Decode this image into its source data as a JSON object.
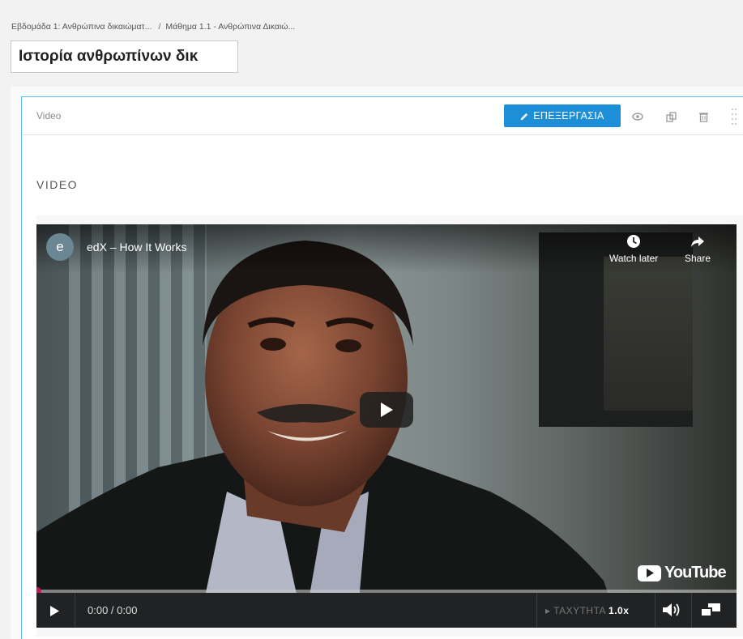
{
  "breadcrumb": {
    "week": "Εβδομάδα 1: Ανθρώπινα δικαιώματ...",
    "separator": "/",
    "lesson": "Μάθημα 1.1 - Ανθρώπινα Δικαιώ..."
  },
  "unit_title": "Ιστορία ανθρωπίνων δικ",
  "component": {
    "type_label": "Video",
    "edit_label": "ΕΠΕΞΕΡΓΑΣΙΑ",
    "section_title": "VIDEO",
    "icons": [
      "pencil-icon",
      "eye-icon",
      "duplicate-icon",
      "delete-icon",
      "drag-handle-icon"
    ]
  },
  "player": {
    "channel_initial": "e",
    "video_title": "edX – How It Works",
    "watch_later_label": "Watch later",
    "share_label": "Share",
    "youtube_label": "YouTube",
    "time": "0:00 / 0:00",
    "speed_label": "ΤΑΧΥΤΗΤΑ",
    "speed_value": "1.0x",
    "progress": 0
  },
  "colors": {
    "accent": "#1d8fd8",
    "panel_border": "#5bbde6",
    "progress_knob": "#c2185b"
  }
}
